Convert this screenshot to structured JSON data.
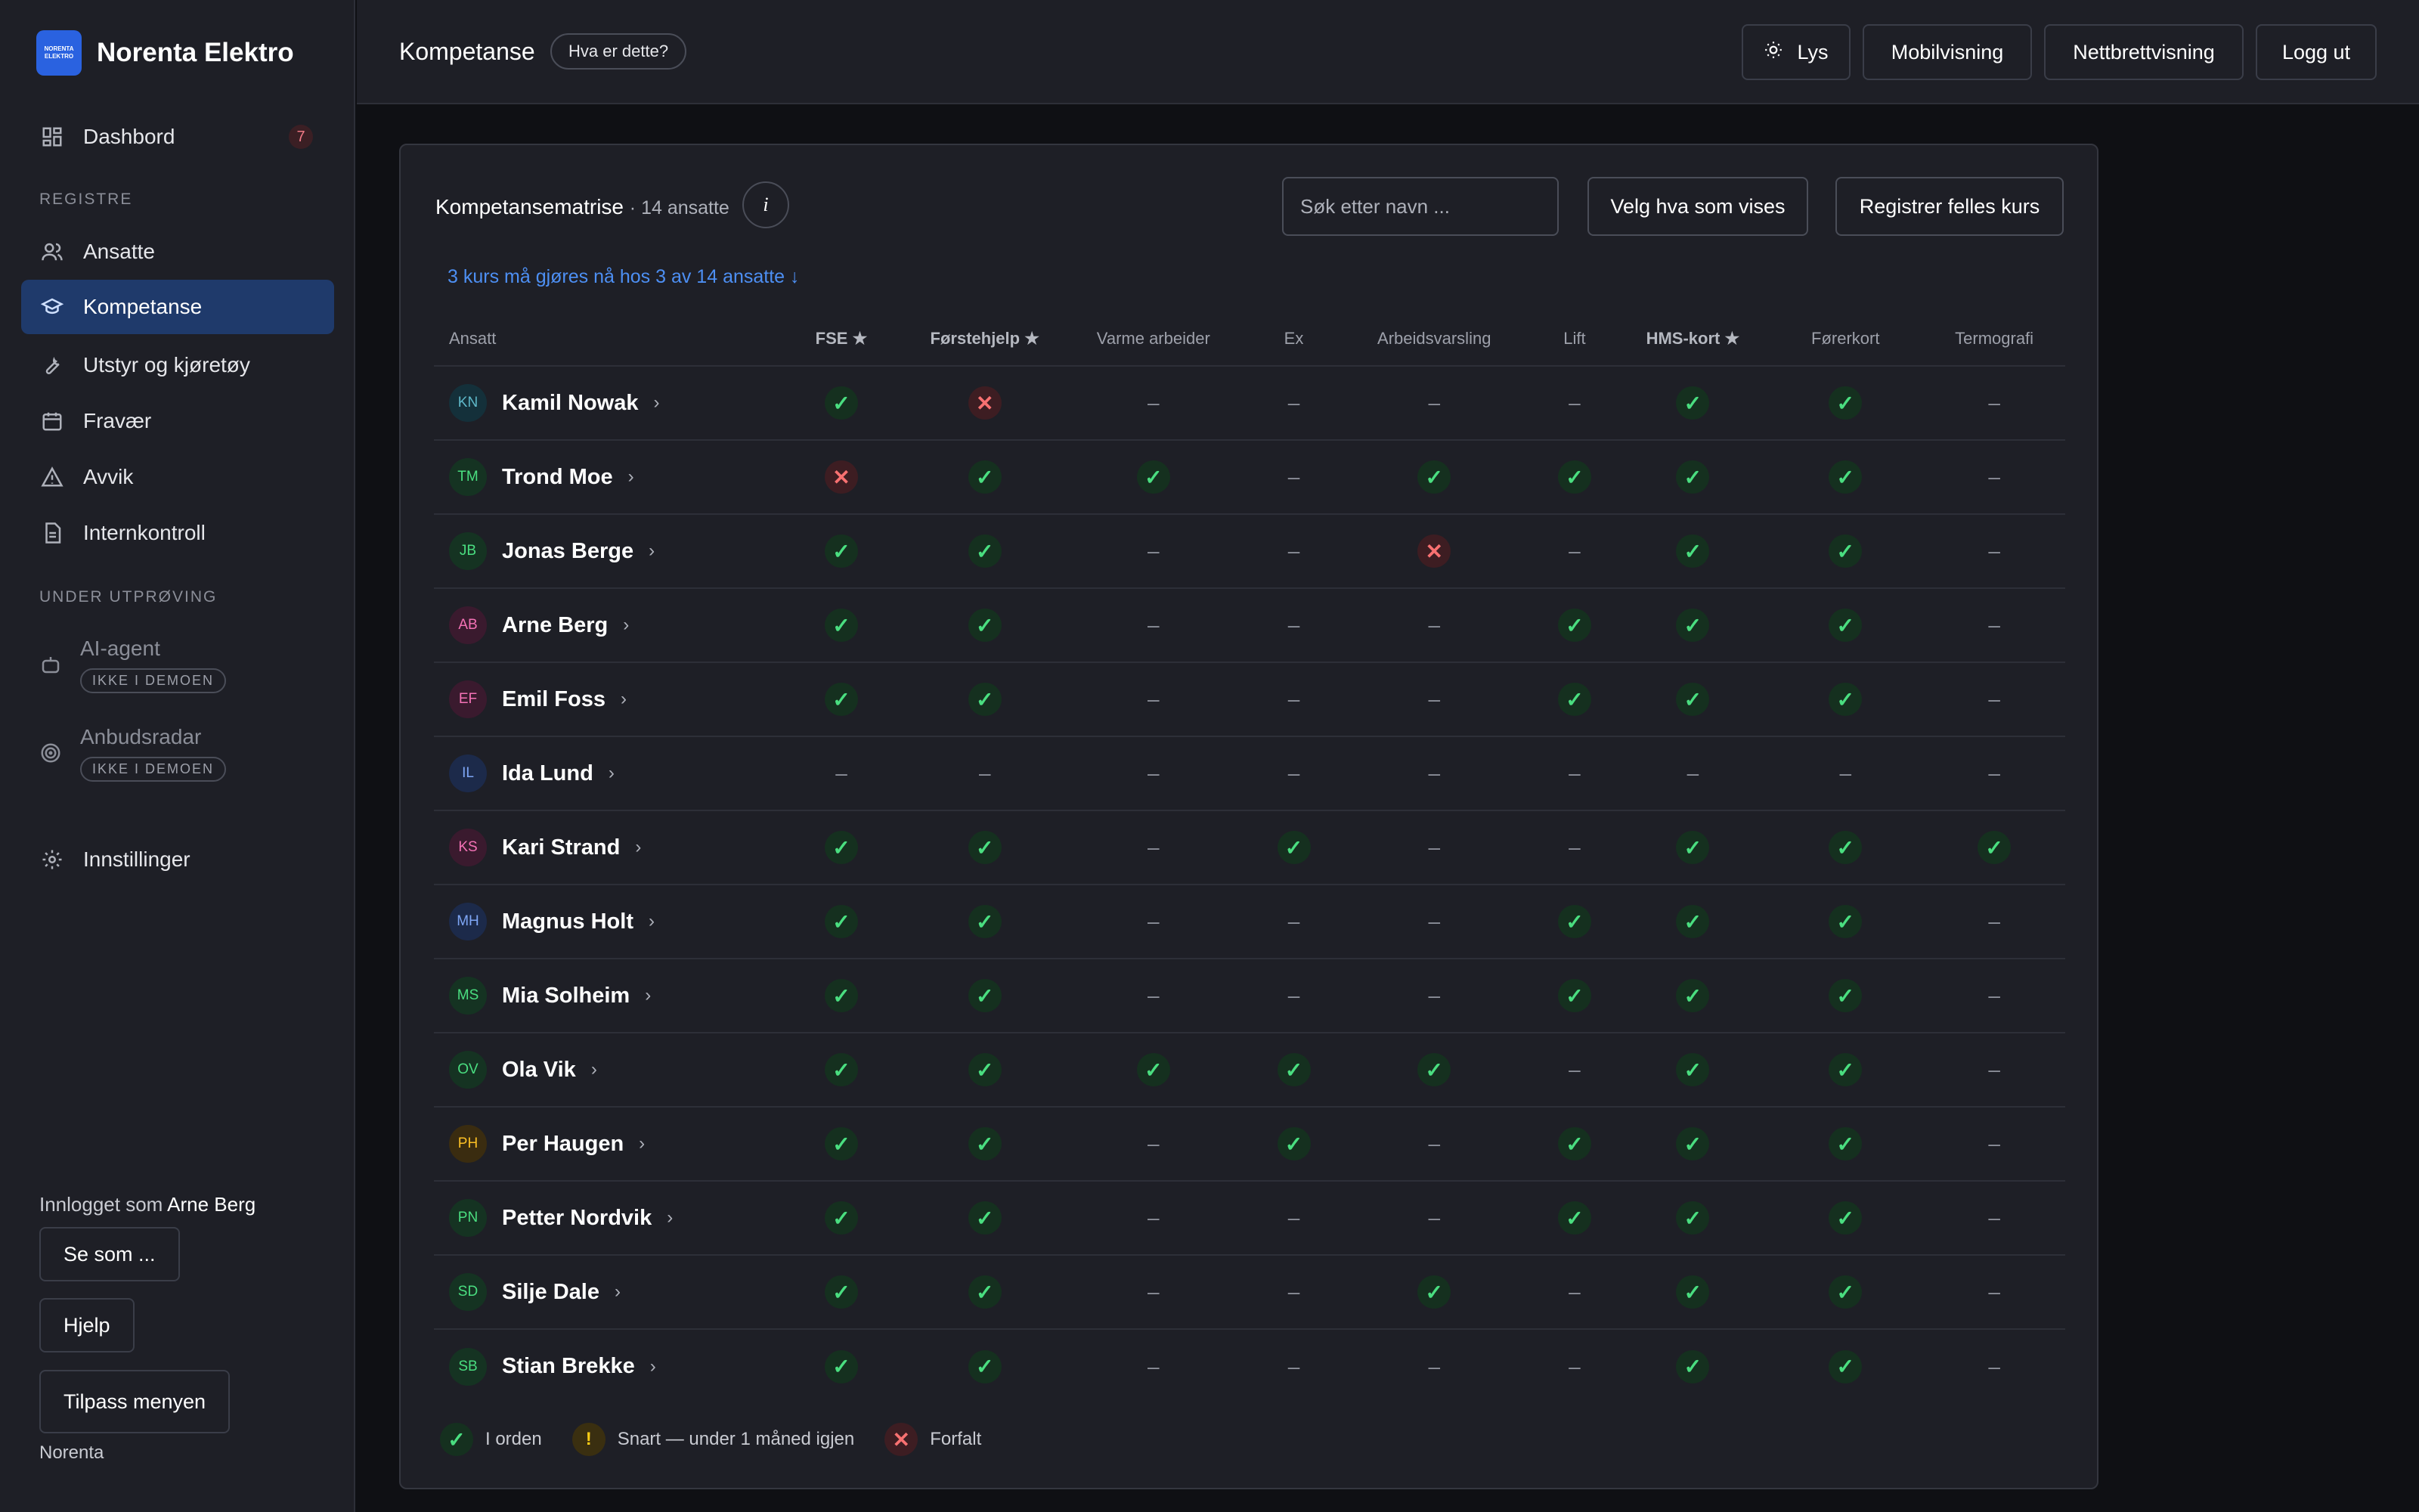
{
  "brand": {
    "logo_line1": "NORENTA",
    "logo_line2": "ELEKTRO",
    "name": "Norenta Elektro"
  },
  "sidebar": {
    "dashboard": {
      "label": "Dashbord",
      "badge": "7"
    },
    "section_registers": "REGISTRE",
    "registers": [
      "Ansatte",
      "Kompetanse",
      "Utstyr og kjøretøy",
      "Fravær",
      "Avvik",
      "Internkontroll"
    ],
    "section_trial": "UNDER UTPRØVING",
    "trial": [
      {
        "label": "AI-agent",
        "badge": "IKKE I DEMOEN"
      },
      {
        "label": "Anbudsradar",
        "badge": "IKKE I DEMOEN"
      }
    ],
    "settings": "Innstillinger",
    "logged_in_prefix": "Innlogget som",
    "logged_in_user": "Arne Berg",
    "view_as": "Se som ...",
    "help": "Hjelp",
    "customize_menu": "Tilpass menyen",
    "footer": "Norenta"
  },
  "topbar": {
    "title": "Kompetanse",
    "help_chip": "Hva er dette?",
    "theme": "Lys",
    "mobile": "Mobilvisning",
    "tablet": "Nettbrettvisning",
    "logout": "Logg ut"
  },
  "card": {
    "title": "Kompetansematrise",
    "subtitle": "· 14 ansatte",
    "info": "i",
    "search_placeholder": "Søk etter navn ...",
    "choose_columns": "Velg hva som vises",
    "register_course": "Registrer felles kurs",
    "alert": "3 kurs må gjøres nå hos 3 av 14 ansatte ↓"
  },
  "matrix": {
    "name_header": "Ansatt",
    "columns": [
      {
        "label": "FSE ★",
        "required": true
      },
      {
        "label": "Førstehjelp ★",
        "required": true
      },
      {
        "label": "Varme arbeider",
        "required": false
      },
      {
        "label": "Ex",
        "required": false
      },
      {
        "label": "Arbeidsvarsling",
        "required": false
      },
      {
        "label": "Lift",
        "required": false
      },
      {
        "label": "HMS-kort ★",
        "required": true
      },
      {
        "label": "Førerkort",
        "required": false
      },
      {
        "label": "Termografi",
        "required": false
      }
    ],
    "rows": [
      {
        "initials": "KN",
        "name": "Kamil Nowak",
        "color": "#5fb8c9",
        "bg": "#14303a",
        "status": [
          "ok",
          "expired",
          "none",
          "none",
          "none",
          "none",
          "ok",
          "ok",
          "none"
        ]
      },
      {
        "initials": "TM",
        "name": "Trond Moe",
        "color": "#4ade80",
        "bg": "#153322",
        "status": [
          "expired",
          "ok",
          "ok",
          "none",
          "ok",
          "ok",
          "ok",
          "ok",
          "none"
        ]
      },
      {
        "initials": "JB",
        "name": "Jonas Berge",
        "color": "#4ade80",
        "bg": "#153322",
        "status": [
          "ok",
          "ok",
          "none",
          "none",
          "expired",
          "none",
          "ok",
          "ok",
          "none"
        ]
      },
      {
        "initials": "AB",
        "name": "Arne Berg",
        "color": "#f472b6",
        "bg": "#3a1a2e",
        "status": [
          "ok",
          "ok",
          "none",
          "none",
          "none",
          "ok",
          "ok",
          "ok",
          "none"
        ]
      },
      {
        "initials": "EF",
        "name": "Emil Foss",
        "color": "#f472b6",
        "bg": "#3a1a2e",
        "status": [
          "ok",
          "ok",
          "none",
          "none",
          "none",
          "ok",
          "ok",
          "ok",
          "none"
        ]
      },
      {
        "initials": "IL",
        "name": "Ida Lund",
        "color": "#7ea6f5",
        "bg": "#1c2a4a",
        "status": [
          "none",
          "none",
          "none",
          "none",
          "none",
          "none",
          "none",
          "none",
          "none"
        ]
      },
      {
        "initials": "KS",
        "name": "Kari Strand",
        "color": "#f472b6",
        "bg": "#3a1a2e",
        "status": [
          "ok",
          "ok",
          "none",
          "ok",
          "none",
          "none",
          "ok",
          "ok",
          "ok"
        ]
      },
      {
        "initials": "MH",
        "name": "Magnus Holt",
        "color": "#7ea6f5",
        "bg": "#1c2a4a",
        "status": [
          "ok",
          "ok",
          "none",
          "none",
          "none",
          "ok",
          "ok",
          "ok",
          "none"
        ]
      },
      {
        "initials": "MS",
        "name": "Mia Solheim",
        "color": "#4ade80",
        "bg": "#153322",
        "status": [
          "ok",
          "ok",
          "none",
          "none",
          "none",
          "ok",
          "ok",
          "ok",
          "none"
        ]
      },
      {
        "initials": "OV",
        "name": "Ola Vik",
        "color": "#4ade80",
        "bg": "#153322",
        "status": [
          "ok",
          "ok",
          "ok",
          "ok",
          "ok",
          "none",
          "ok",
          "ok",
          "none"
        ]
      },
      {
        "initials": "PH",
        "name": "Per Haugen",
        "color": "#fbbf24",
        "bg": "#3a2c10",
        "status": [
          "ok",
          "ok",
          "none",
          "ok",
          "none",
          "ok",
          "ok",
          "ok",
          "none"
        ]
      },
      {
        "initials": "PN",
        "name": "Petter Nordvik",
        "color": "#4ade80",
        "bg": "#153322",
        "status": [
          "ok",
          "ok",
          "none",
          "none",
          "none",
          "ok",
          "ok",
          "ok",
          "none"
        ]
      },
      {
        "initials": "SD",
        "name": "Silje Dale",
        "color": "#4ade80",
        "bg": "#153322",
        "status": [
          "ok",
          "ok",
          "none",
          "none",
          "ok",
          "none",
          "ok",
          "ok",
          "none"
        ]
      },
      {
        "initials": "SB",
        "name": "Stian Brekke",
        "color": "#4ade80",
        "bg": "#153322",
        "status": [
          "ok",
          "ok",
          "none",
          "none",
          "none",
          "none",
          "ok",
          "ok",
          "none"
        ]
      }
    ]
  },
  "legend": {
    "ok": "I orden",
    "soon": "Snart — under 1 måned igjen",
    "expired": "Forfalt"
  },
  "colors": {
    "accent": "#2a62e0",
    "ok": "#4ade80",
    "expired": "#f87171",
    "soon": "#facc15",
    "link": "#4d8ff3"
  }
}
